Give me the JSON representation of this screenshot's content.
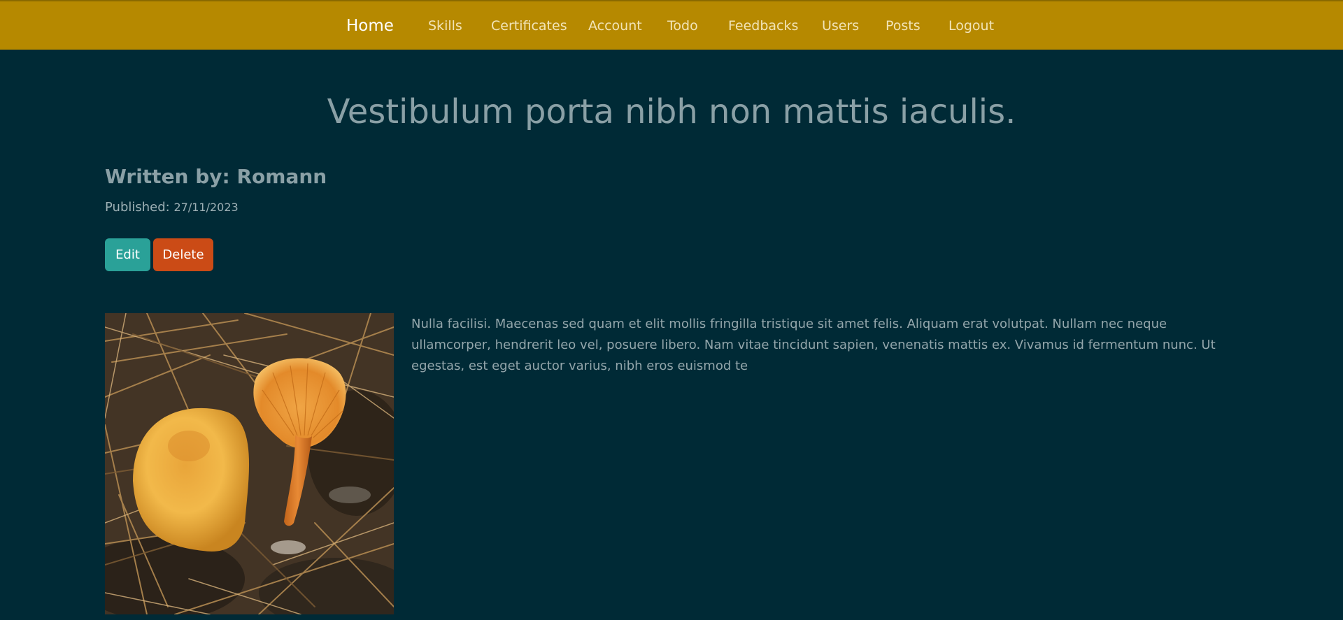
{
  "nav": {
    "brand": "Home",
    "links": [
      "Skills",
      "Certificates",
      "Account",
      "Todo",
      "Feedbacks",
      "Users",
      "Posts",
      "Logout"
    ]
  },
  "post": {
    "title": "Vestibulum porta nibh non mattis iaculis.",
    "author_line": "Written by: Romann",
    "published_label": "Published:",
    "published_date": "27/11/2023",
    "body": "Nulla facilisi. Maecenas sed quam et elit mollis fringilla tristique sit amet felis. Aliquam erat volutpat. Nullam nec neque ullamcorper, hendrerit leo vel, posuere libero. Nam vitae tincidunt sapien, venenatis mattis ex. Vivamus id fermentum nunc. Ut egestas, est eget auctor varius, nibh eros euismod te"
  },
  "actions": {
    "edit_label": "Edit",
    "delete_label": "Delete"
  },
  "colors": {
    "navbar": "#b68900",
    "background": "#002a36",
    "edit": "#2aa198",
    "delete": "#cb4b16"
  }
}
